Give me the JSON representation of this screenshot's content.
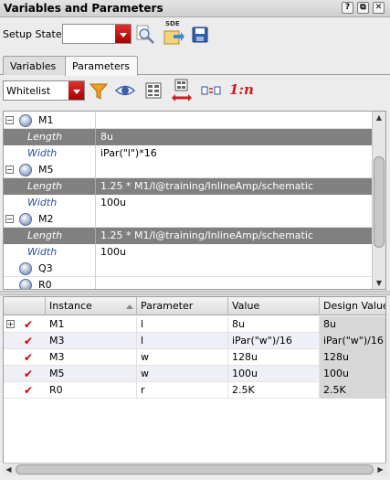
{
  "window": {
    "title": "Variables and Parameters",
    "buttons": {
      "help": "?",
      "float": "⧉",
      "close": "✕"
    }
  },
  "setup": {
    "label": "Setup State:",
    "value": "",
    "sde_label": "SDE"
  },
  "tabs": [
    {
      "label": "Variables",
      "active": false
    },
    {
      "label": "Parameters",
      "active": true
    }
  ],
  "filter": {
    "value": "Whitelist",
    "ratio_label": "1:n"
  },
  "tree": {
    "rows": [
      {
        "kind": "instance",
        "expander": "−",
        "name": "M1",
        "value": ""
      },
      {
        "kind": "param",
        "name": "Length",
        "value": "8u"
      },
      {
        "kind": "param",
        "name": "Width",
        "value": "iPar(\"l\")*16"
      },
      {
        "kind": "instance",
        "expander": "−",
        "name": "M5",
        "value": ""
      },
      {
        "kind": "param",
        "name": "Length",
        "value": "1.25 * M1/l@training/InlineAmp/schematic"
      },
      {
        "kind": "param",
        "name": "Width",
        "value": "100u"
      },
      {
        "kind": "instance",
        "expander": "−",
        "name": "M2",
        "value": ""
      },
      {
        "kind": "param",
        "name": "Length",
        "value": "1.25 * M1/l@training/InlineAmp/schematic"
      },
      {
        "kind": "param",
        "name": "Width",
        "value": "100u"
      },
      {
        "kind": "instance",
        "expander": "",
        "name": "Q3",
        "value": ""
      },
      {
        "kind": "instance",
        "expander": "",
        "name": "R0",
        "value": ""
      }
    ]
  },
  "grid": {
    "columns": [
      "Instance",
      "Parameter",
      "Value",
      "Design Value"
    ],
    "rows": [
      {
        "expander": "+",
        "instance": "M1",
        "parameter": "l",
        "value": "8u",
        "design_value": "8u"
      },
      {
        "expander": "",
        "instance": "M3",
        "parameter": "l",
        "value": "iPar(\"w\")/16",
        "design_value": "iPar(\"w\")/16"
      },
      {
        "expander": "",
        "instance": "M3",
        "parameter": "w",
        "value": "128u",
        "design_value": "128u"
      },
      {
        "expander": "",
        "instance": "M5",
        "parameter": "w",
        "value": "100u",
        "design_value": "100u"
      },
      {
        "expander": "",
        "instance": "R0",
        "parameter": "r",
        "value": "2.5K",
        "design_value": "2.5K"
      }
    ]
  },
  "colors": {
    "accent_red": "#cc0000",
    "param_row_dark": "#808080",
    "param_label_blue": "#2a4fa0"
  }
}
